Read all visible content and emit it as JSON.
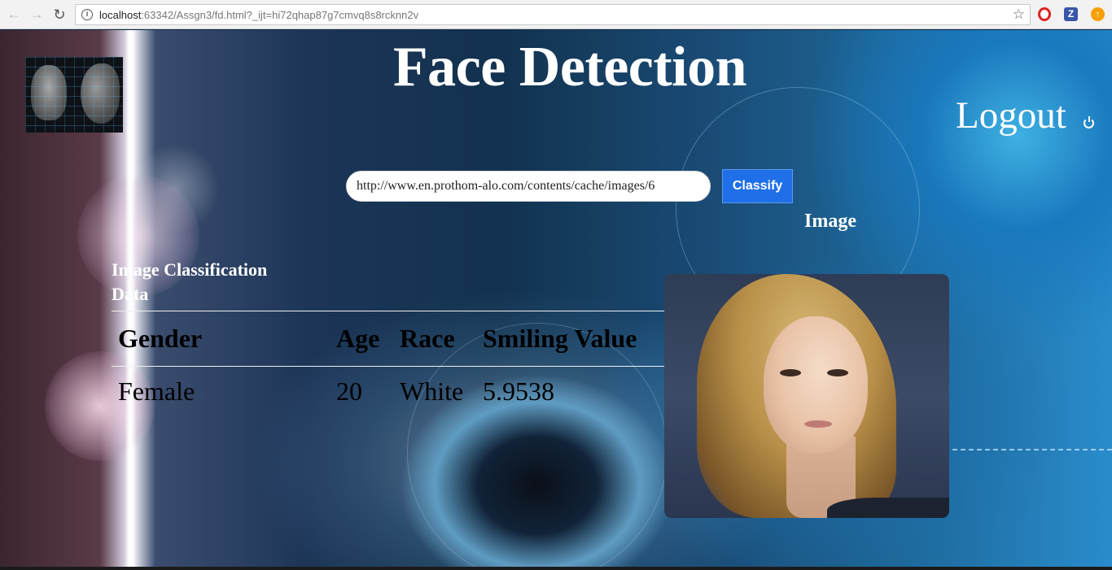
{
  "browser": {
    "url_host": "localhost",
    "url_rest": ":63342/Assgn3/fd.html?_ijt=hi72qhap87g7cmvq8s8rcknn2v",
    "back_icon": "←",
    "forward_icon": "→",
    "reload_icon": "↻",
    "info_icon": "i",
    "star_icon": "☆",
    "ext_z_label": "Z",
    "ext_up_icon": "↑"
  },
  "header": {
    "title": "Face Detection",
    "logout_label": "Logout"
  },
  "search": {
    "url_value": "http://www.en.prothom-alo.com/contents/cache/images/6",
    "classify_label": "Classify"
  },
  "results": {
    "image_heading": "Image",
    "section_heading": "Image Classification Data",
    "columns": [
      "Gender",
      "Age",
      "Race",
      "Smiling Value"
    ],
    "rows": [
      [
        "Female",
        "20",
        "White",
        "5.9538"
      ]
    ]
  }
}
